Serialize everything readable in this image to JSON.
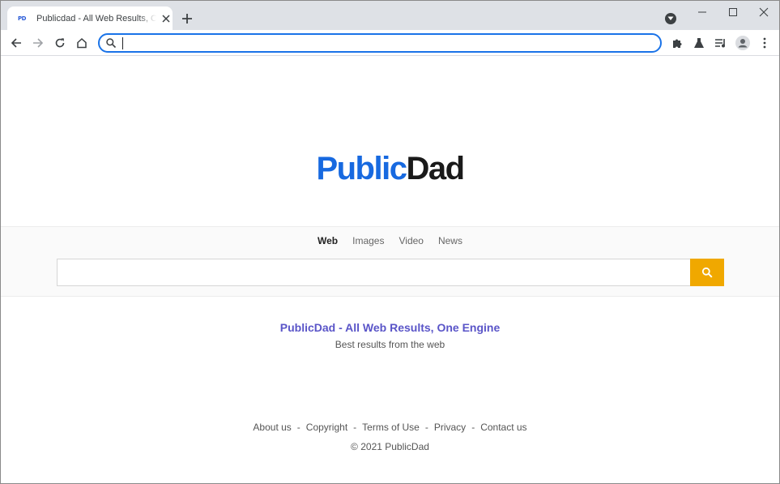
{
  "browser": {
    "tab": {
      "favicon_text": "PD",
      "title": "Publicdad - All Web Results, One Engine"
    },
    "omnibox": {
      "value": "",
      "placeholder": ""
    },
    "accent_color": "#1a73e8"
  },
  "page": {
    "logo": {
      "part1": "Public",
      "part2": "Dad",
      "part1_color": "#1769e0",
      "part2_color": "#1a1a1a"
    },
    "nav_tabs": [
      {
        "label": "Web",
        "active": true
      },
      {
        "label": "Images",
        "active": false
      },
      {
        "label": "Video",
        "active": false
      },
      {
        "label": "News",
        "active": false
      }
    ],
    "search": {
      "value": "",
      "placeholder": "",
      "button_color": "#f0a800"
    },
    "tagline": "PublicDad - All Web Results, One Engine",
    "subtagline": "Best results from the web",
    "footer": {
      "links": [
        "About us",
        "Copyright",
        "Terms of Use",
        "Privacy",
        "Contact us"
      ],
      "separator": "-",
      "copyright": "© 2021 PublicDad"
    }
  }
}
